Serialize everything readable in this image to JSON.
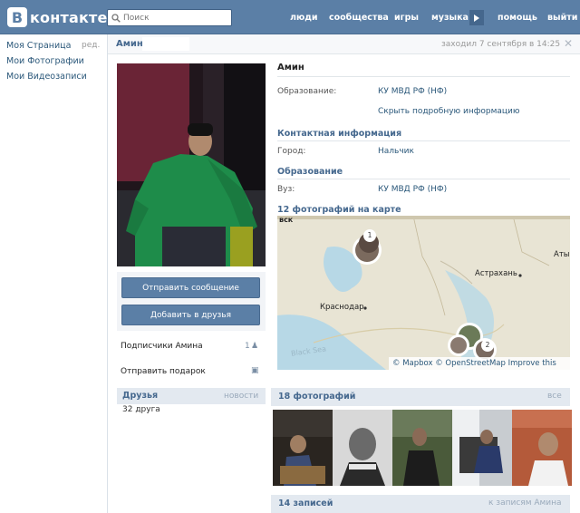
{
  "header": {
    "logo_letter": "В",
    "logo_text": "контакте",
    "search_placeholder": "Поиск",
    "nav": [
      "люди",
      "сообщества",
      "игры",
      "музыка",
      "помощь",
      "выйти"
    ]
  },
  "left_menu": {
    "items": [
      "Моя Страница",
      "Мои Фотографии",
      "Мои Видеозаписи"
    ],
    "edit": "ред."
  },
  "profile": {
    "name": "Амин",
    "last_seen": "заходил 7 сентября в 14:25",
    "actions": {
      "send_message": "Отправить сообщение",
      "add_friend": "Добавить в друзья"
    },
    "subscribers_label": "Подписчики Амина",
    "subscribers_count": "1",
    "gift_label": "Отправить подарок",
    "friends": {
      "title": "Друзья",
      "news_link": "новости",
      "count_text": "32 друга"
    },
    "info": {
      "heading_name": "Амин",
      "education_label": "Образование:",
      "education_value": "КУ МВД РФ (НФ)",
      "hide_details": "Скрыть подробную информацию",
      "contacts_title": "Контактная информация",
      "city_label": "Город:",
      "city_value": "Нальчик",
      "education_title": "Образование",
      "university_label": "Вуз:",
      "university_value": "КУ МВД РФ (НФ)",
      "map_title": "12 фотографий на карте"
    },
    "map": {
      "labels": [
        "вск",
        "Астрахань",
        "Аты",
        "Краснодар"
      ],
      "sea_label": "Black Sea",
      "markers": [
        "1",
        "2"
      ],
      "credit": "© Mapbox © OpenStreetMap Improve this map"
    },
    "photos": {
      "title": "18 фотографий",
      "all_link": "все"
    },
    "posts": {
      "title": "14 записей",
      "all_link": "к записям Амина"
    }
  }
}
